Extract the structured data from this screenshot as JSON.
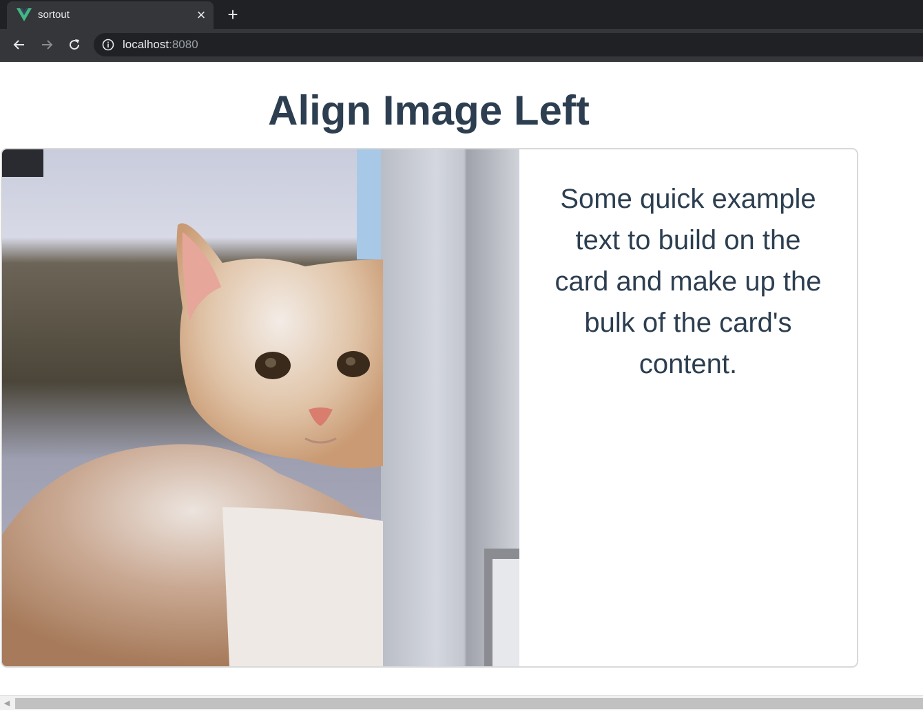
{
  "browser": {
    "tab": {
      "title": "sortout",
      "favicon": "vue-logo-icon"
    },
    "new_tab_icon": "plus-icon",
    "close_icon": "close-icon",
    "nav": {
      "back": "arrow-left-icon",
      "forward": "arrow-right-icon",
      "reload": "reload-icon"
    },
    "address": {
      "host": "localhost",
      "port": ":8080",
      "info_icon": "info-icon"
    }
  },
  "page": {
    "title": "Align Image Left",
    "card": {
      "image": "kitten-photo",
      "text": "Some quick example text to build on the card and make up the bulk of the card's content."
    }
  },
  "colors": {
    "heading": "#2c3e50",
    "vue_green": "#42b883",
    "vue_dark": "#35495e"
  }
}
